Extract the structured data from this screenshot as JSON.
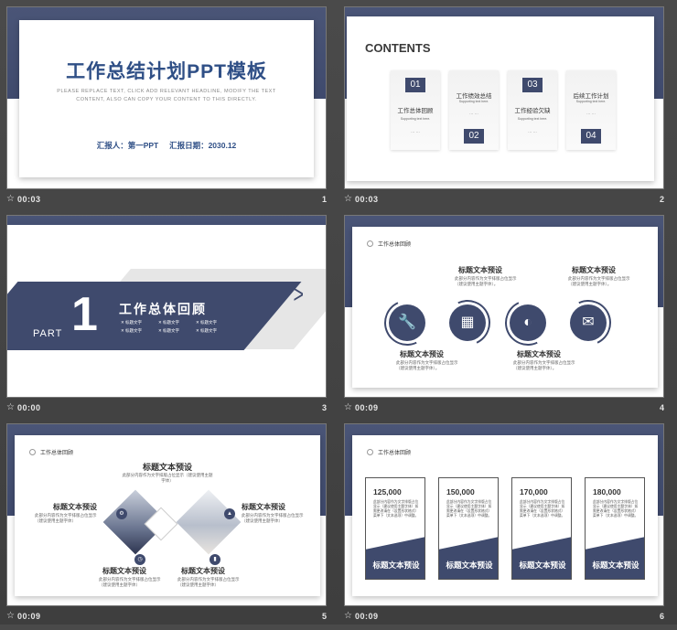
{
  "slides": [
    {
      "number": "1",
      "time": "00:03",
      "title": "工作总结计划PPT模板",
      "subtitle": "PLEASE REPLACE TEXT, CLICK ADD RELEVANT HEADLINE, MODIFY THE TEXT CONTENT, ALSO CAN COPY YOUR CONTENT TO THIS DIRECTLY.",
      "reporter": "汇报人：第一PPT",
      "report_date": "汇报日期：2030.12"
    },
    {
      "number": "2",
      "time": "00:03",
      "title": "CONTENTS",
      "items": [
        {
          "num": "01",
          "label": "工作总体回顾",
          "sub": "Supporting text here.",
          "dots": "... ..."
        },
        {
          "num": "02",
          "label": "工作绩效总结",
          "sub": "Supporting text here.",
          "dots": "... ..."
        },
        {
          "num": "03",
          "label": "工作经验欠缺",
          "sub": "Supporting text here.",
          "dots": "... ..."
        },
        {
          "num": "04",
          "label": "后续工作计划",
          "sub": "Supporting text here.",
          "dots": "... ..."
        }
      ]
    },
    {
      "number": "3",
      "time": "00:00",
      "part": "PART",
      "part_num": "1",
      "heading": "工作总体回顾",
      "bullets": [
        "标题文字",
        "标题文字",
        "标题文字",
        "标题文字",
        "标题文字",
        "标题文字"
      ]
    },
    {
      "number": "4",
      "time": "00:09",
      "header": "工作总体回顾",
      "blocks": [
        {
          "title": "标题文本预设",
          "desc": "此部分内容作为文字排版占位显示（建议使用主题字体）。"
        },
        {
          "title": "标题文本预设",
          "desc": "此部分内容作为文字排版占位显示（建议使用主题字体）。"
        },
        {
          "title": "标题文本预设",
          "desc": "此部分内容作为文字排版占位显示（建议使用主题字体）。"
        },
        {
          "title": "标题文本预设",
          "desc": "此部分内容作为文字排版占位显示（建议使用主题字体）。"
        }
      ],
      "icons": [
        "wrench-icon",
        "calendar-icon",
        "palette-icon",
        "mail-icon"
      ]
    },
    {
      "number": "5",
      "time": "00:09",
      "header": "工作总体回顾",
      "top_title": "标题文本预设",
      "top_desc": "此部分内容作为文字排版占位显示（建议使用主题字体）",
      "blocks": [
        {
          "title": "标题文本预设",
          "desc": "此部分内容作为文字排版占位显示（建议使用主题字体）"
        },
        {
          "title": "标题文本预设",
          "desc": "此部分内容作为文字排版占位显示（建议使用主题字体）"
        },
        {
          "title": "标题文本预设",
          "desc": "此部分内容作为文字排版占位显示（建议使用主题字体）"
        },
        {
          "title": "标题文本预设",
          "desc": "此部分内容作为文字排版占位显示（建议使用主题字体）"
        }
      ]
    },
    {
      "number": "6",
      "time": "00:09",
      "header": "工作总体回顾",
      "cards": [
        {
          "value": "125,000",
          "desc": "此部分内容作为文字排版占位显示（建议使用主题字体）如需更改请在（设置形状格式）菜单下（文本选项）中调整。",
          "label": "标题文本预设"
        },
        {
          "value": "150,000",
          "desc": "此部分内容作为文字排版占位显示（建议使用主题字体）如需更改请在（设置形状格式）菜单下（文本选项）中调整。",
          "label": "标题文本预设"
        },
        {
          "value": "170,000",
          "desc": "此部分内容作为文字排版占位显示（建议使用主题字体）如需更改请在（设置形状格式）菜单下（文本选项）中调整。",
          "label": "标题文本预设"
        },
        {
          "value": "180,000",
          "desc": "此部分内容作为文字排版占位显示（建议使用主题字体）如需更改请在（设置形状格式）菜单下（文本选项）中调整。",
          "label": "标题文本预设"
        }
      ]
    }
  ],
  "colors": {
    "navy": "#3f4a6d",
    "title_blue": "#2f4f86",
    "background": "#444444"
  }
}
